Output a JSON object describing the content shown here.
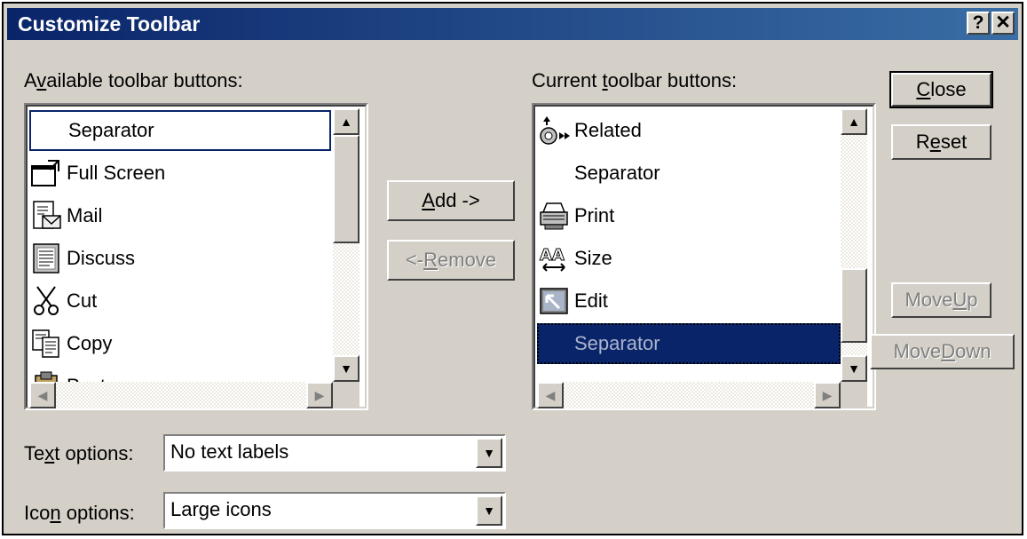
{
  "window": {
    "title": "Customize Toolbar",
    "help_label": "?",
    "close_label": "✕"
  },
  "available": {
    "label_pre": "A",
    "label_key": "v",
    "label_post": "ailable toolbar buttons:",
    "items": [
      {
        "label": "Separator",
        "icon": "none"
      },
      {
        "label": "Full Screen",
        "icon": "full-screen-icon"
      },
      {
        "label": "Mail",
        "icon": "mail-icon"
      },
      {
        "label": "Discuss",
        "icon": "discuss-icon"
      },
      {
        "label": "Cut",
        "icon": "scissors-icon"
      },
      {
        "label": "Copy",
        "icon": "copy-icon"
      },
      {
        "label": "Paste",
        "icon": "paste-icon"
      }
    ]
  },
  "current": {
    "label_pre": "Current ",
    "label_key": "t",
    "label_post": "oolbar buttons:",
    "items": [
      {
        "label": "Related",
        "icon": "related-icon"
      },
      {
        "label": "Separator",
        "icon": "none"
      },
      {
        "label": "Print",
        "icon": "printer-icon"
      },
      {
        "label": "Size",
        "icon": "font-size-icon"
      },
      {
        "label": "Edit",
        "icon": "edit-icon"
      },
      {
        "label": "Separator",
        "icon": "none"
      }
    ]
  },
  "buttons": {
    "close_key": "C",
    "close_rest": "lose",
    "reset_pre": "R",
    "reset_key": "e",
    "reset_rest": "set",
    "add_key": "A",
    "add_rest": "dd ->",
    "remove_pre": "<- ",
    "remove_key": "R",
    "remove_rest": "emove",
    "moveup_pre": "Move ",
    "moveup_key": "U",
    "moveup_rest": "p",
    "movedown_pre": "Move ",
    "movedown_key": "D",
    "movedown_rest": "own"
  },
  "text_options": {
    "label_pre": "Te",
    "label_key": "x",
    "label_post": "t options:",
    "value": "No text labels"
  },
  "icon_options": {
    "label_pre": "Ico",
    "label_key": "n",
    "label_post": " options:",
    "value": "Large icons"
  },
  "colors": {
    "title_bar_start": "#0a246a",
    "title_bar_end": "#3a6ea5",
    "dialog_face": "#d4d0c8",
    "selection": "#0a246a"
  }
}
